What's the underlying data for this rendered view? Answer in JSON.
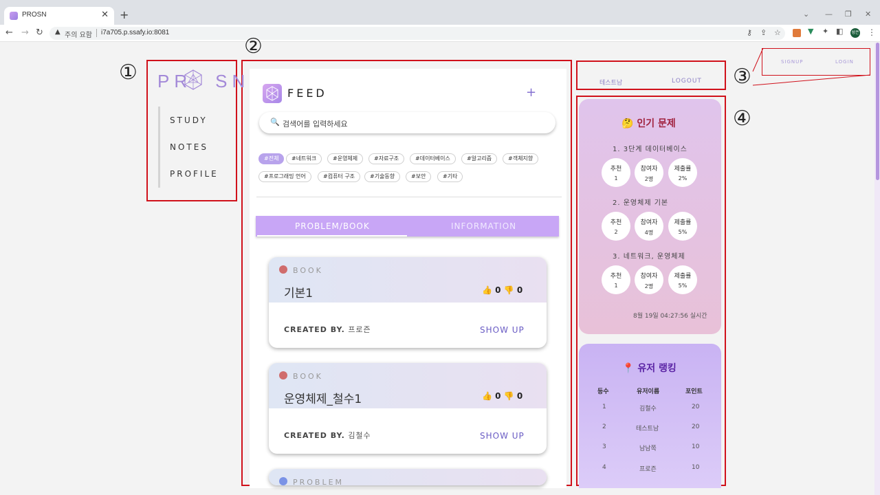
{
  "browser": {
    "tab_title": "PROSN",
    "tab_close": "✕",
    "new_tab": "+",
    "security_warning": "주의 요함",
    "url": "i7a705.p.ssafy.io:8081",
    "profile_initials": "성은"
  },
  "annotations": [
    "①",
    "②",
    "③",
    "④"
  ],
  "nav": {
    "logo_left": "PR",
    "logo_right": "SN",
    "items": [
      {
        "label": "STUDY"
      },
      {
        "label": "NOTES"
      },
      {
        "label": "PROFILE"
      }
    ]
  },
  "feed": {
    "title": "FEED",
    "add_label": "+",
    "search_placeholder": "검색어를 입력하세요",
    "tags": [
      "#전체",
      "#네트워크",
      "#운영체제",
      "#자료구조",
      "#데이터베이스",
      "#알고리즘",
      "#객체지향",
      "#프로그래밍 언어",
      "#컴퓨터 구조",
      "#기술동향",
      "#보안",
      "#기타"
    ],
    "active_tag": "#전체",
    "tabs": [
      {
        "label": "PROBLEM/BOOK",
        "active": true
      },
      {
        "label": "INFORMATION",
        "active": false
      }
    ],
    "posts": [
      {
        "type": "BOOK",
        "title": "기본1",
        "likes": "0",
        "dislikes": "0",
        "created_by_label": "CREATED BY.",
        "author": "프로즌",
        "action": "SHOW UP",
        "dot_color": "#d06c6c"
      },
      {
        "type": "BOOK",
        "title": "운영체제_철수1",
        "likes": "0",
        "dislikes": "0",
        "created_by_label": "CREATED BY.",
        "author": "김철수",
        "action": "SHOW UP",
        "dot_color": "#d06c6c"
      },
      {
        "type": "PROBLEM",
        "title": "",
        "likes": "",
        "dislikes": "",
        "created_by_label": "",
        "author": "",
        "action": "",
        "dot_color": "#7b93e6"
      }
    ]
  },
  "auth_logged_in": {
    "user": "테스트남",
    "logout": "LOGOUT"
  },
  "auth_logged_out": {
    "signup": "SIGNUP",
    "login": "LOGIN"
  },
  "popular": {
    "heading": "인기 문제",
    "items": [
      {
        "title": "1. 3단계 데이터베이스",
        "stats": [
          {
            "label": "추천",
            "value": "1"
          },
          {
            "label": "참여자",
            "value": "2명"
          },
          {
            "label": "제출률",
            "value": "2%"
          }
        ]
      },
      {
        "title": "2. 운영체제 기본",
        "stats": [
          {
            "label": "추천",
            "value": "2"
          },
          {
            "label": "참여자",
            "value": "4명"
          },
          {
            "label": "제출률",
            "value": "5%"
          }
        ]
      },
      {
        "title": "3. 네트워크, 운영체제",
        "stats": [
          {
            "label": "추천",
            "value": "1"
          },
          {
            "label": "참여자",
            "value": "2명"
          },
          {
            "label": "제출률",
            "value": "5%"
          }
        ]
      }
    ],
    "timestamp": "8월 19일 04:27:56 실시간"
  },
  "ranking": {
    "heading": "유저 랭킹",
    "columns": [
      "등수",
      "유저이름",
      "포인트"
    ],
    "rows": [
      [
        "1",
        "김철수",
        "20"
      ],
      [
        "2",
        "테스트남",
        "20"
      ],
      [
        "3",
        "남남쪽",
        "10"
      ],
      [
        "4",
        "프로즌",
        "10"
      ]
    ]
  },
  "colors": {
    "accent": "#a389d8",
    "annotation": "#d0101a",
    "tab_bar": "#c8a6f6",
    "tab_active_text": "#ffffff",
    "tab_inactive_text": "#f1eaff"
  }
}
